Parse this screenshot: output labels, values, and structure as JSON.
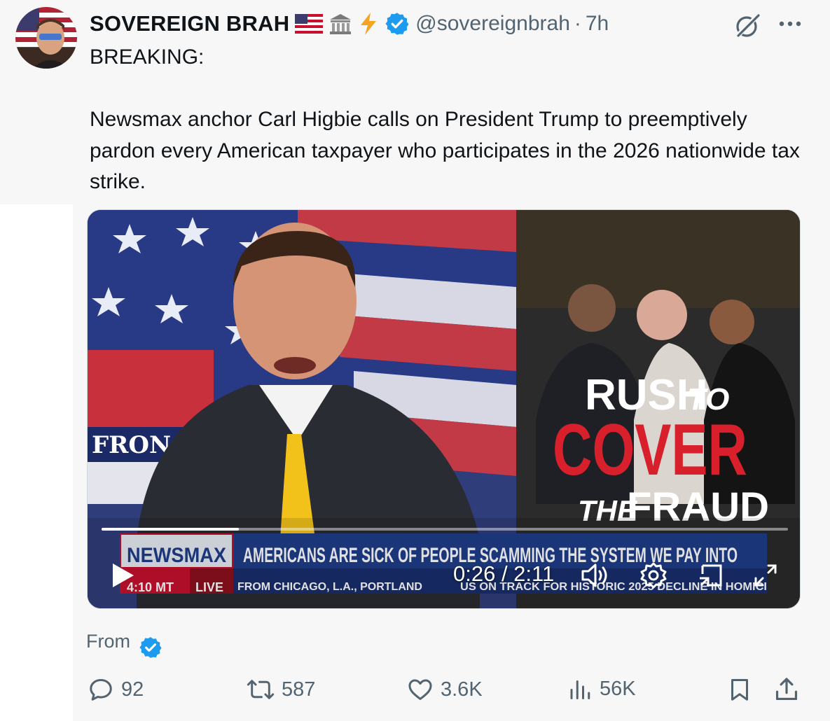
{
  "tweet": {
    "display_name": "SOVEREIGN BRAH",
    "name_emojis": [
      "us-flag-icon",
      "classical-building-icon",
      "lightning-icon"
    ],
    "verified": true,
    "handle": "@sovereignbrah",
    "separator": "·",
    "time": "7h",
    "text": "BREAKING:\n\nNewsmax anchor Carl Higbie calls on President Trump to preemptively pardon every American taxpayer who participates in the 2026 nationwide tax strike."
  },
  "video": {
    "chyron": {
      "network": "NEWSMAX",
      "headline": "AMERICANS ARE SICK OF PEOPLE SCAMMING THE SYSTEM WE PAY INTO",
      "clock": "4:10 MT",
      "live_label": "LIVE",
      "ticker_left": "FROM CHICAGO, L.A., PORTLAND",
      "ticker_right": "US ON TRACK FOR HISTORIC 2025 DECLINE IN HOMICI"
    },
    "graphic_text": {
      "line1a": "RUSH",
      "line1b": "TO",
      "line2": "COVER",
      "line3a": "THE",
      "line3b": "FRAUD"
    },
    "studio_sign": "FRON",
    "current_time": "0:26",
    "duration": "2:11",
    "time_readout": "0:26 / 2:11",
    "progress": 0.2
  },
  "from_label": "From",
  "actions": {
    "replies": "92",
    "reposts": "587",
    "likes": "3.6K",
    "views": "56K"
  },
  "colors": {
    "accent": "#1d9bf0",
    "muted": "#536471",
    "background": "#f7f7f7",
    "newsmax_red": "#c8102e",
    "chyron_blue": "#1f3d8a"
  }
}
